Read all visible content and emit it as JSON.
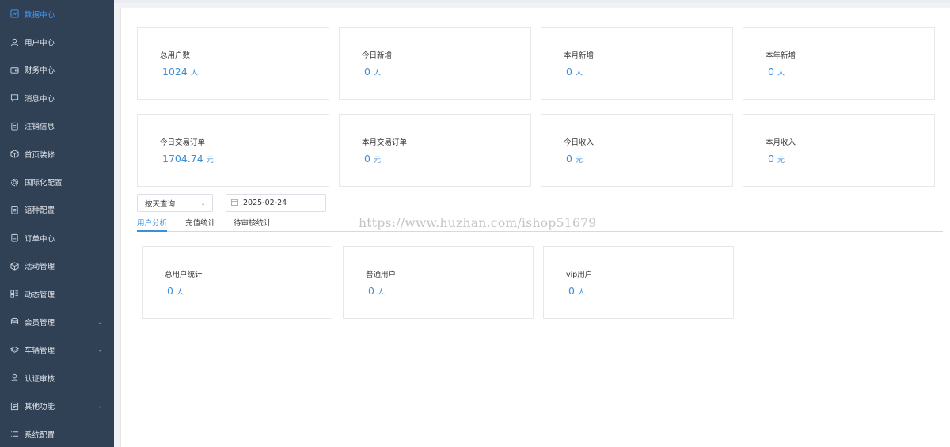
{
  "sidebar": {
    "items": [
      {
        "label": "数据中心",
        "icon": "chart-icon",
        "active": true
      },
      {
        "label": "用户中心",
        "icon": "user-icon"
      },
      {
        "label": "财务中心",
        "icon": "wallet-icon"
      },
      {
        "label": "消息中心",
        "icon": "message-icon"
      },
      {
        "label": "注销信息",
        "icon": "clipboard-icon"
      },
      {
        "label": "首页装修",
        "icon": "box-icon"
      },
      {
        "label": "国际化配置",
        "icon": "gear-icon"
      },
      {
        "label": "语种配置",
        "icon": "clipboard-icon"
      },
      {
        "label": "订单中心",
        "icon": "clipboard-icon"
      },
      {
        "label": "活动管理",
        "icon": "box-icon"
      },
      {
        "label": "动态管理",
        "icon": "grid-icon"
      },
      {
        "label": "会员管理",
        "icon": "coins-icon",
        "expandable": true
      },
      {
        "label": "车辆管理",
        "icon": "layers-icon",
        "expandable": true
      },
      {
        "label": "认证审核",
        "icon": "user-icon"
      },
      {
        "label": "其他功能",
        "icon": "document-icon",
        "expandable": true
      },
      {
        "label": "系统配置",
        "icon": "list-icon"
      }
    ]
  },
  "stats_row1": [
    {
      "label": "总用户数",
      "value": "1024",
      "unit": "人"
    },
    {
      "label": "今日新增",
      "value": "0",
      "unit": "人"
    },
    {
      "label": "本月新增",
      "value": "0",
      "unit": "人"
    },
    {
      "label": "本年新增",
      "value": "0",
      "unit": "人"
    }
  ],
  "stats_row2": [
    {
      "label": "今日交易订单",
      "value": "1704.74",
      "unit": "元"
    },
    {
      "label": "本月交易订单",
      "value": "0",
      "unit": "元"
    },
    {
      "label": "今日收入",
      "value": "0",
      "unit": "元"
    },
    {
      "label": "本月收入",
      "value": "0",
      "unit": "元"
    }
  ],
  "filters": {
    "query_mode": "按天查询",
    "date": "2025-02-24"
  },
  "tabs": [
    {
      "label": "用户分析",
      "active": true
    },
    {
      "label": "充值统计"
    },
    {
      "label": "待审核统计"
    }
  ],
  "user_stats": [
    {
      "label": "总用户统计",
      "value": "0",
      "unit": "人"
    },
    {
      "label": "普通用户",
      "value": "0",
      "unit": "人"
    },
    {
      "label": "vip用户",
      "value": "0",
      "unit": "人"
    }
  ],
  "watermark": "https://www.huzhan.com/ishop51679",
  "colors": {
    "sidebar_bg": "#304156",
    "accent": "#409eff",
    "value_blue": "#3f8fd6"
  }
}
